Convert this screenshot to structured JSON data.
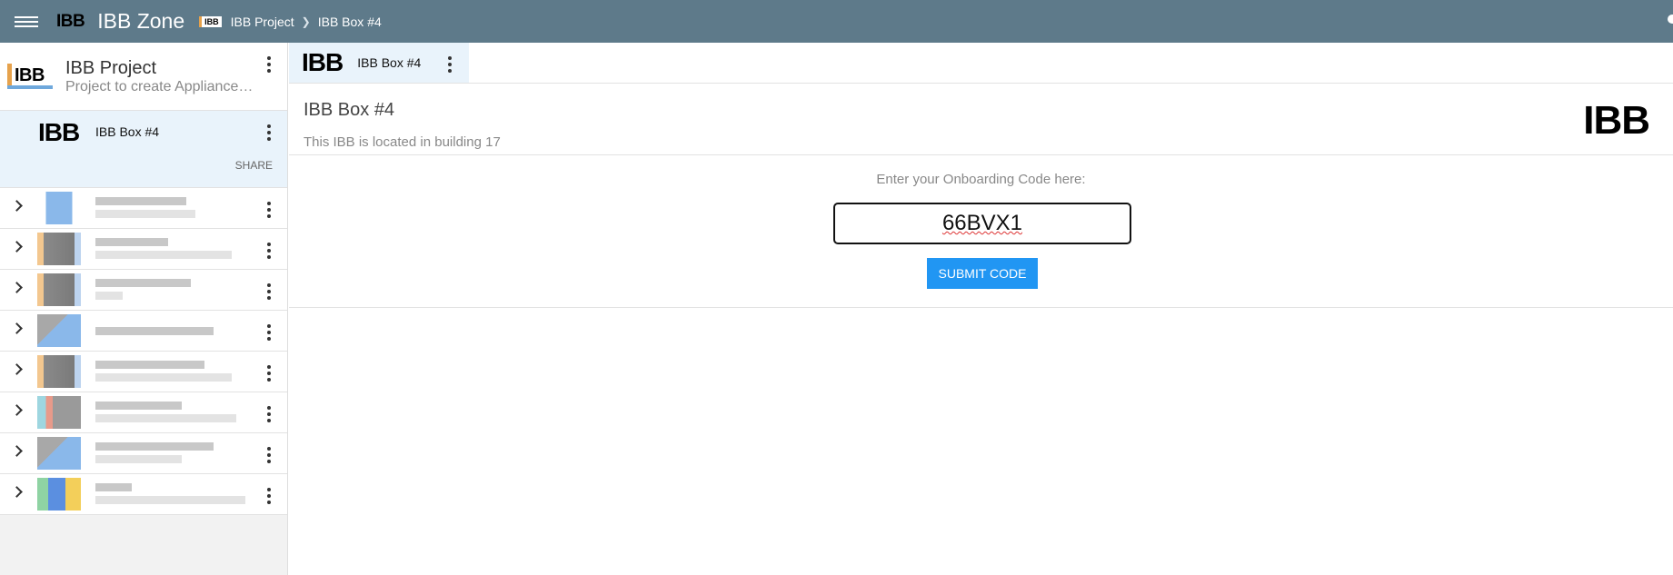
{
  "topbar": {
    "logo_text": "IBB",
    "app_title": "IBB Zone",
    "breadcrumb_logo": "IBB",
    "breadcrumbs": [
      "IBB Project",
      "IBB Box #4"
    ],
    "separator": "❯"
  },
  "sidebar": {
    "project": {
      "logo_text": "IBB",
      "name": "IBB Project",
      "description": "Project to create Appliance f..."
    },
    "selected_box": {
      "logo_text": "IBB",
      "name": "IBB Box #4",
      "share_label": "SHARE"
    },
    "items_count": 8
  },
  "main": {
    "tab": {
      "logo_text": "IBB",
      "name": "IBB Box #4"
    },
    "detail": {
      "title": "IBB Box #4",
      "description": "This IBB is located in building 17",
      "logo_text": "IBB"
    },
    "onboarding": {
      "label": "Enter your Onboarding Code here:",
      "code_value": "66BVX1",
      "submit_label": "SUBMIT CODE"
    }
  },
  "colors": {
    "topbar": "#5e7a8a",
    "accent": "#2196f3",
    "selected_bg": "#e9f3fb",
    "logo_orange": "#e6a24c"
  }
}
